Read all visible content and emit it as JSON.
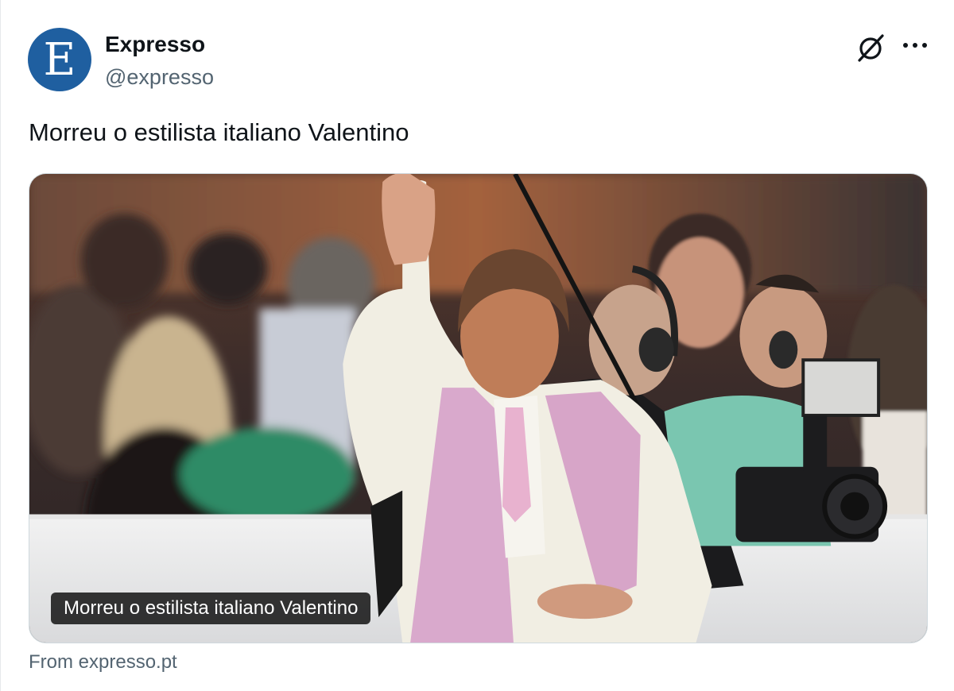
{
  "author": {
    "avatar_letter": "E",
    "display_name": "Expresso",
    "handle": "@expresso"
  },
  "header_icons": {
    "grok": "grok-icon",
    "more": "more-icon"
  },
  "tweet": {
    "text": "Morreu o estilista italiano Valentino"
  },
  "link_card": {
    "caption": "Morreu o estilista italiano Valentino",
    "source": "From expresso.pt"
  },
  "colors": {
    "avatar_bg": "#1f5fa0",
    "secondary_text": "#536471",
    "border": "#cfd9de"
  }
}
